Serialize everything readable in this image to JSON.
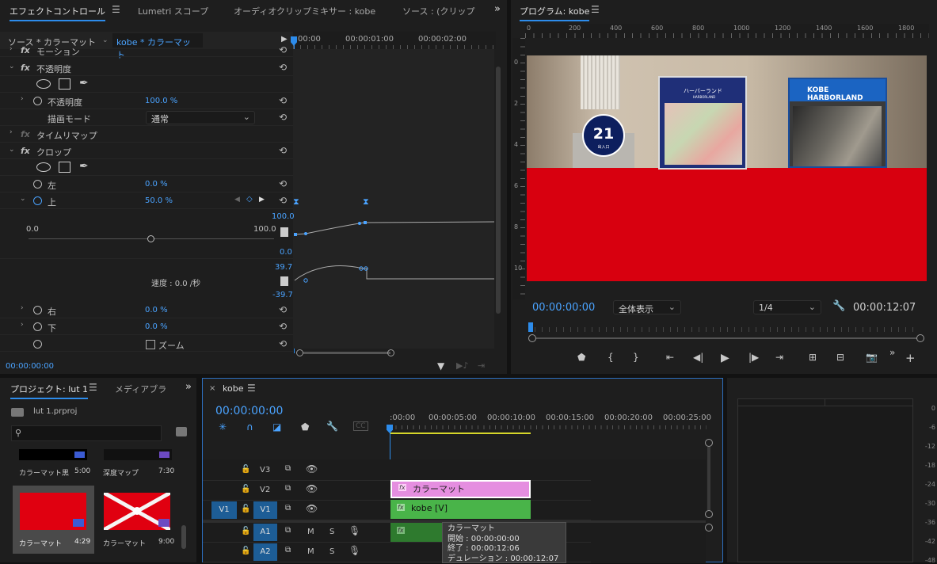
{
  "effect_controls": {
    "tabs": [
      "エフェクトコントロール",
      "Lumetri スコープ",
      "オーディオクリップミキサー : kobe",
      "ソース : (クリップな"
    ],
    "source_label": "ソース * カラーマット",
    "clip_label": "kobe * カラーマット",
    "ruler_times": [
      "00:00",
      "00:00:01:00",
      "00:00:02:00"
    ],
    "rows": {
      "motion": "モーション",
      "opacity_group": "不透明度",
      "opacity_prop": "不透明度",
      "opacity_val": "100.0 %",
      "blend_mode": "描画モード",
      "blend_val": "通常",
      "time_remap": "タイムリマップ",
      "crop": "クロップ",
      "left": "左",
      "left_val": "0.0 %",
      "top": "上",
      "top_val": "50.0 %",
      "slider_min": "0.0",
      "slider_max": "100.0",
      "graph_max": "100.0",
      "graph_zero": "0.0",
      "vel_max": "39.7",
      "vel_min": "-39.7",
      "speed": "速度 : 0.0 /秒",
      "right": "右",
      "right_val": "0.0 %",
      "bottom": "下",
      "bottom_val": "0.0 %",
      "zoom": "ズーム"
    },
    "timecode": "00:00:00:00"
  },
  "program": {
    "title": "プログラム: kobe",
    "ruler": [
      "0",
      "200",
      "400",
      "600",
      "800",
      "1000",
      "1200",
      "1400",
      "1600",
      "1800"
    ],
    "vruler": [
      "0",
      "2",
      "4",
      "6",
      "8",
      "10"
    ],
    "image_text": {
      "harborland_jp": "ハーバーランド",
      "harborland_en": "HARBORLAND",
      "kobe_sign": "KOBE HARBORLAND",
      "sign_number": "21",
      "sign_small": "出入口"
    },
    "timecode": "00:00:00:00",
    "zoom_select": "全体表示",
    "res_select": "1/4",
    "duration": "00:00:12:07"
  },
  "project": {
    "tabs": [
      "プロジェクト: lut 1",
      "メディアブラ"
    ],
    "file": "lut 1.prproj",
    "search_placeholder": "",
    "items": [
      {
        "name": "カラーマット黒",
        "dur": "5:00"
      },
      {
        "name": "深度マップ",
        "dur": "7:30"
      },
      {
        "name": "カラーマット",
        "dur": "4:29"
      },
      {
        "name": "カラーマット",
        "dur": "9:00"
      }
    ]
  },
  "timeline": {
    "title": "kobe",
    "timecode": "00:00:00:00",
    "ruler": [
      ":00:00",
      "00:00:05:00",
      "00:00:10:00",
      "00:00:15:00",
      "00:00:20:00",
      "00:00:25:00"
    ],
    "tracks": {
      "v3": "V3",
      "v2": "V2",
      "v1": "V1",
      "v1src": "V1",
      "a1": "A1",
      "a2": "A2",
      "m": "M",
      "s": "S"
    },
    "clips": {
      "matte": "カラーマット",
      "kobe": "kobe [V]"
    },
    "tooltip": {
      "name": "カラーマット",
      "start": "開始 : 00:00:00:00",
      "end": "終了 : 00:00:12:06",
      "dur": "デュレーション : 00:00:12:07"
    }
  },
  "meter": {
    "labels": [
      "0",
      "-6",
      "-12",
      "-18",
      "-24",
      "-30",
      "-36",
      "-42",
      "-48"
    ]
  },
  "colors": {
    "accent": "#2d8ceb",
    "matte_red": "#d8000f",
    "clip_pink": "#e58ee0",
    "clip_green": "#49b449"
  }
}
